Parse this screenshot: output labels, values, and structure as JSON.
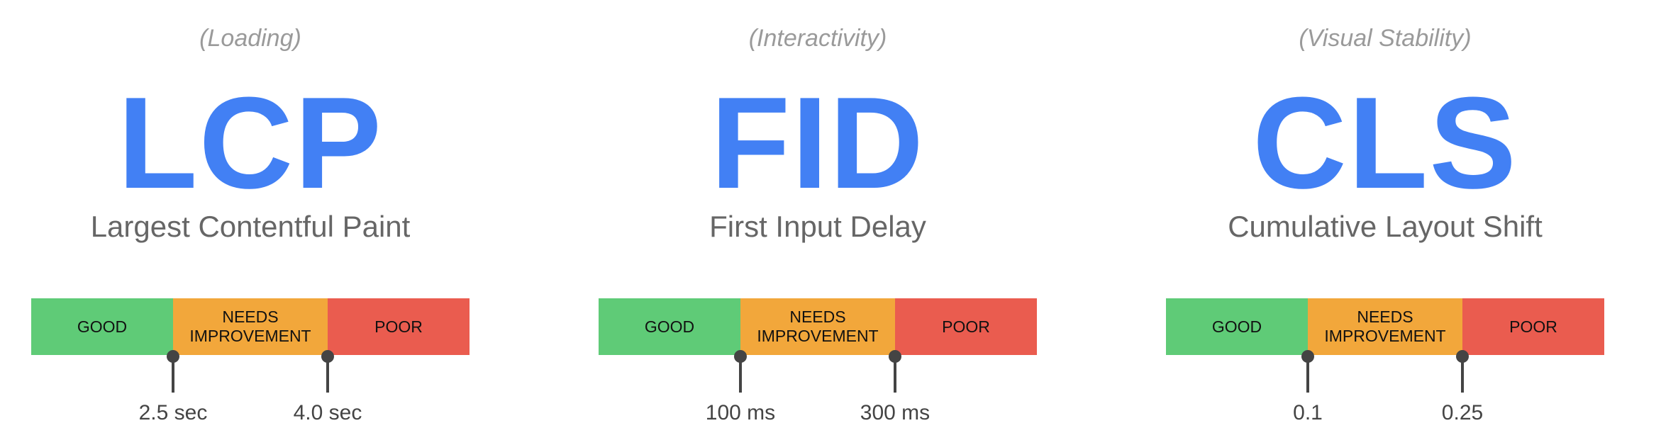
{
  "colors": {
    "acronym": "#4280f4",
    "good": "#5fcb77",
    "needs_improvement": "#f2a73b",
    "poor": "#ea5c4f",
    "marker": "#444444"
  },
  "metrics": [
    {
      "category": "(Loading)",
      "acronym": "LCP",
      "name": "Largest Contentful Paint",
      "bands": {
        "good": "GOOD",
        "needs_improvement_line1": "NEEDS",
        "needs_improvement_line2": "IMPROVEMENT",
        "poor": "POOR"
      },
      "thresholds": [
        "2.5 sec",
        "4.0 sec"
      ]
    },
    {
      "category": "(Interactivity)",
      "acronym": "FID",
      "name": "First Input Delay",
      "bands": {
        "good": "GOOD",
        "needs_improvement_line1": "NEEDS",
        "needs_improvement_line2": "IMPROVEMENT",
        "poor": "POOR"
      },
      "thresholds": [
        "100 ms",
        "300 ms"
      ]
    },
    {
      "category": "(Visual Stability)",
      "acronym": "CLS",
      "name": "Cumulative Layout Shift",
      "bands": {
        "good": "GOOD",
        "needs_improvement_line1": "NEEDS",
        "needs_improvement_line2": "IMPROVEMENT",
        "poor": "POOR"
      },
      "thresholds": [
        "0.1",
        "0.25"
      ]
    }
  ]
}
